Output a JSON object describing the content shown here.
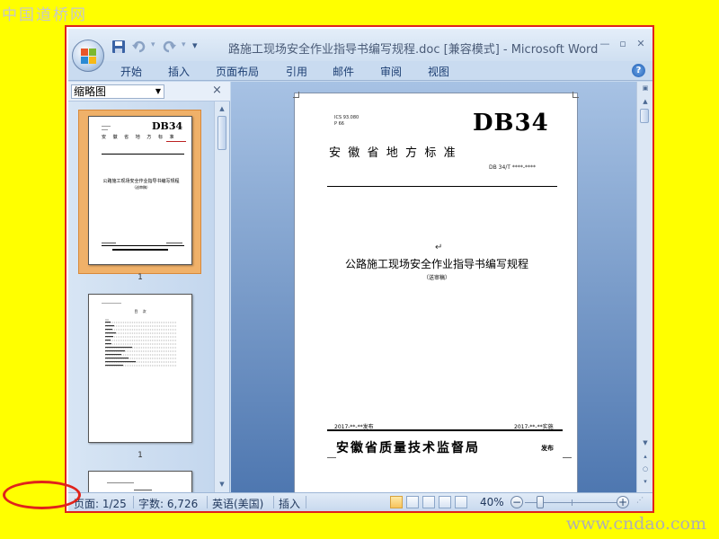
{
  "watermark": {
    "top": "中国道桥网",
    "bottom": "www.cndao.com"
  },
  "window": {
    "title": "路施工现场安全作业指导书编写规程.doc [兼容模式] - Microsoft Word",
    "quick_access": {
      "save_icon": "save-icon",
      "undo_icon": "undo-icon",
      "redo_icon": "redo-icon",
      "dropdown": "▾"
    }
  },
  "ribbon": {
    "tabs": [
      "开始",
      "插入",
      "页面布局",
      "引用",
      "邮件",
      "审阅",
      "视图"
    ],
    "help": "?"
  },
  "nav_pane": {
    "view_select": "缩略图",
    "close": "×",
    "thumbnails": [
      {
        "page_label": "1",
        "selected": true
      },
      {
        "page_label": "1",
        "selected": false
      }
    ]
  },
  "document": {
    "code_line1": "ICS 93.080",
    "code_line2": "P 66",
    "db_label": "DB34",
    "province_title": "安  徽  省  地  方  标  准",
    "standard_no": "DB 34/T ****-****",
    "return_mark": "↵",
    "main_title": "公路施工现场安全作业指导书编写规程",
    "subtitle": "（送审稿）",
    "issue_date": "2017-**-**发布",
    "implement_date": "2017-**-**实施",
    "issuer": "安徽省质量技术监督局",
    "issuer_suffix": "发布"
  },
  "thumb_page1": {
    "db": "DB34",
    "header_row": "安 徽 省 地 方 标 准",
    "title": "公路施工现场安全作业指导书编写规程",
    "subtitle": "（送审稿）"
  },
  "thumb_page2": {
    "toc_title": "目 次"
  },
  "status_bar": {
    "page": "页面: 1/25",
    "words": "字数: 6,726",
    "language": "英语(美国)",
    "mode": "插入",
    "zoom": "40%",
    "zoom_minus": "−",
    "zoom_plus": "+"
  },
  "colors": {
    "highlight_red": "#e0231b",
    "selected_thumb": "#f0b169",
    "background": "#ffff00"
  }
}
